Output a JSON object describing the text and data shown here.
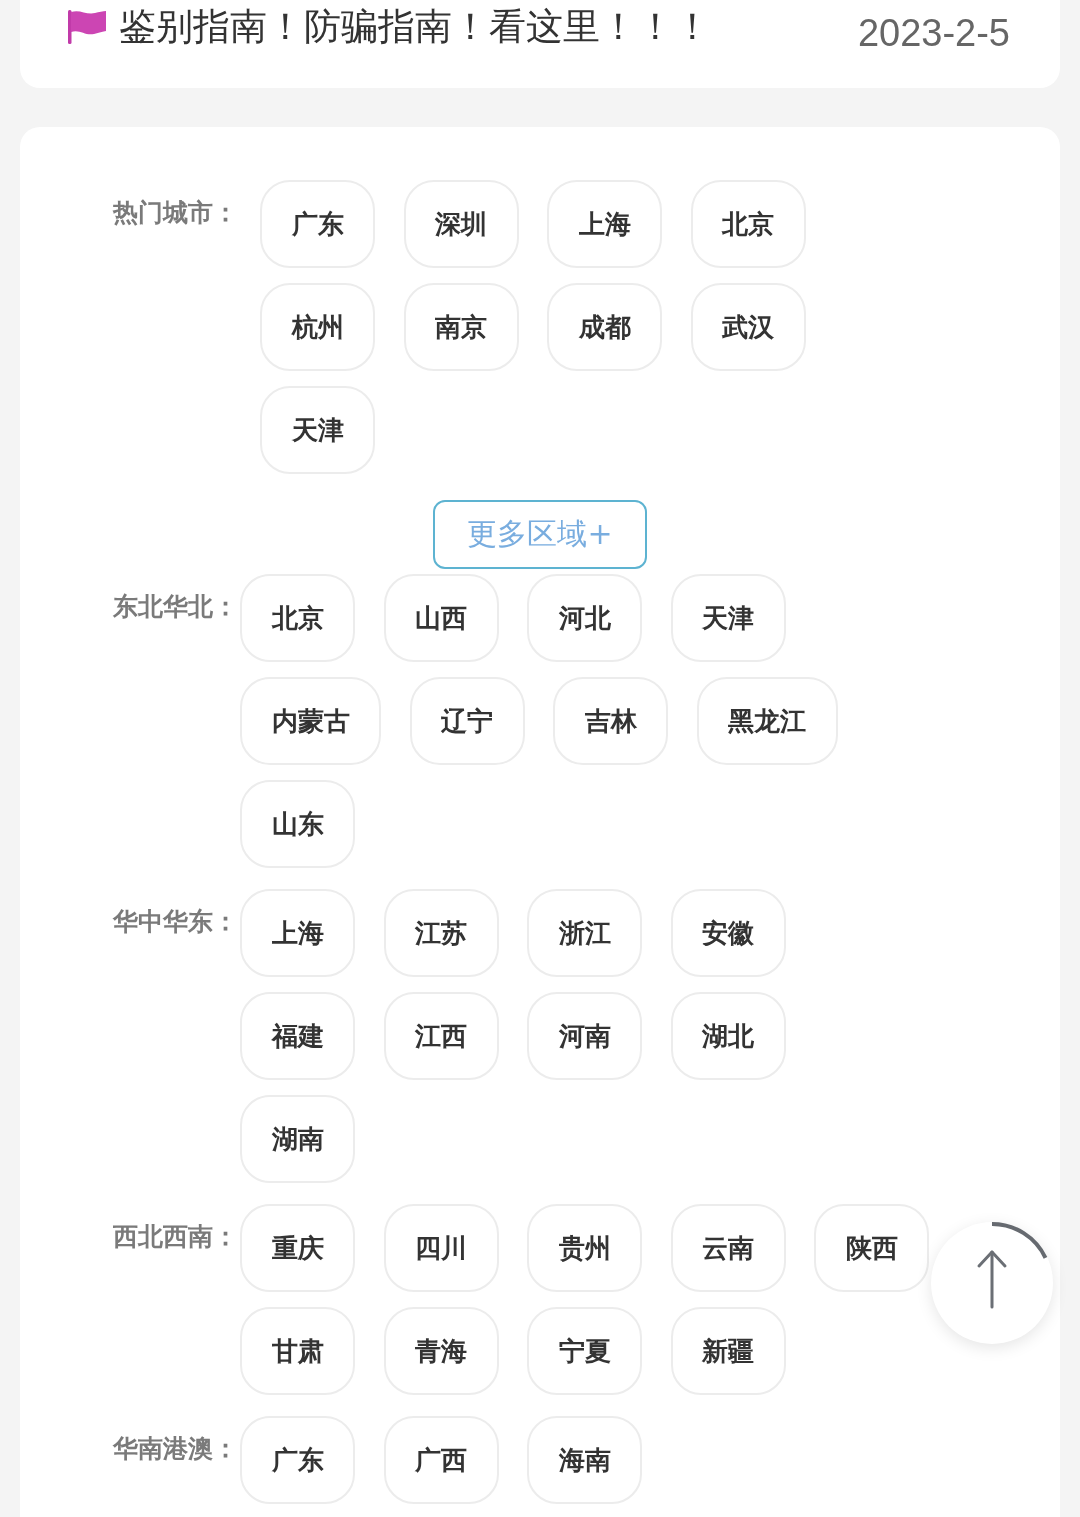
{
  "notice": {
    "title": "鉴别指南！防骗指南！看这里！！！",
    "date": "2023-2-5"
  },
  "hot_cities": {
    "label": "热门城市：",
    "rows": [
      [
        "广东",
        "深圳",
        "上海",
        "北京"
      ],
      [
        "杭州",
        "南京",
        "成都",
        "武汉"
      ],
      [
        "天津"
      ]
    ]
  },
  "more_button": {
    "label": "更多区域+"
  },
  "regions": [
    {
      "label": "东北华北：",
      "rows": [
        [
          "北京",
          "山西",
          "河北",
          "天津"
        ],
        [
          "内蒙古",
          "辽宁",
          "吉林",
          "黑龙江"
        ],
        [
          "山东"
        ]
      ]
    },
    {
      "label": "华中华东：",
      "rows": [
        [
          "上海",
          "江苏",
          "浙江",
          "安徽"
        ],
        [
          "福建",
          "江西",
          "河南",
          "湖北"
        ],
        [
          "湖南"
        ]
      ]
    },
    {
      "label": "西北西南：",
      "rows": [
        [
          "重庆",
          "四川",
          "贵州",
          "云南",
          "陕西"
        ],
        [
          "甘肃",
          "青海",
          "宁夏",
          "新疆"
        ]
      ]
    },
    {
      "label": "华南港澳：",
      "rows": [
        [
          "广东",
          "广西",
          "海南"
        ]
      ]
    }
  ]
}
